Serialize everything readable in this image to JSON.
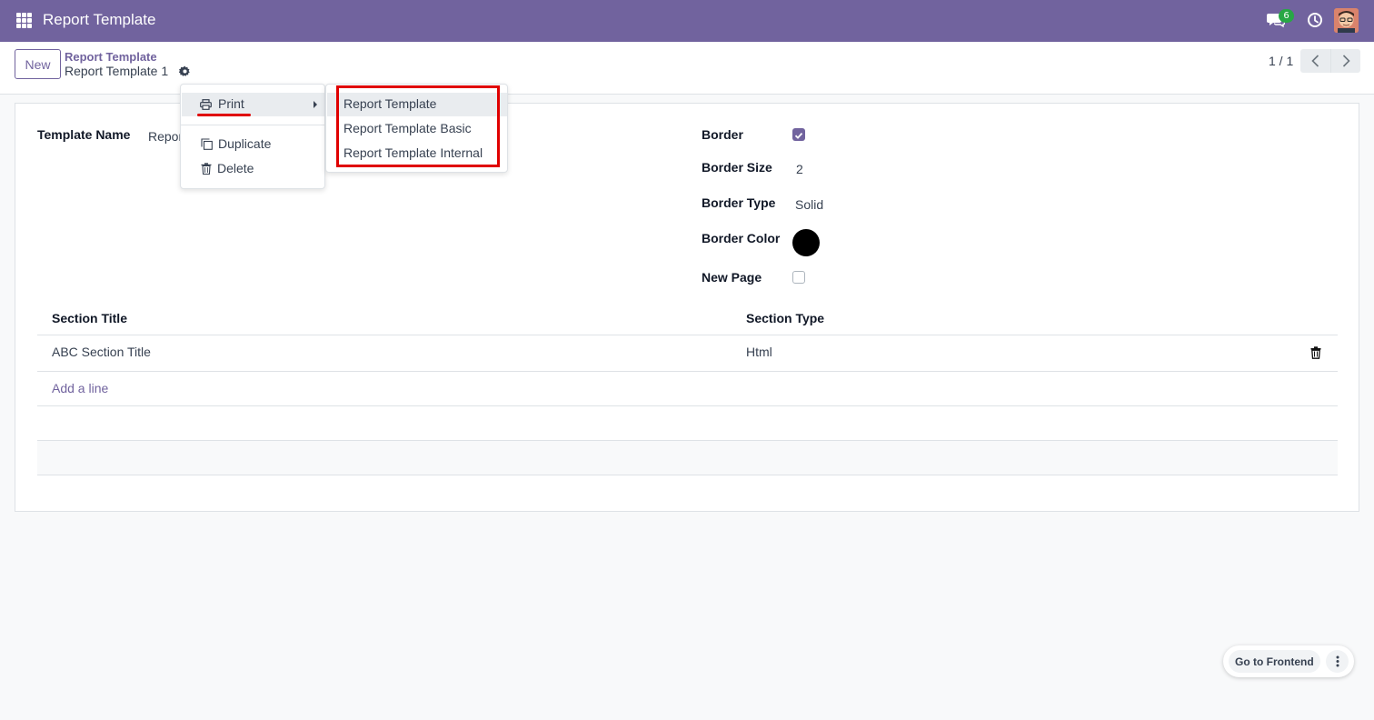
{
  "navbar": {
    "title": "Report Template",
    "chat_count": "6"
  },
  "control_panel": {
    "new_label": "New",
    "breadcrumb_parent": "Report Template",
    "breadcrumb_current": "Report Template 1",
    "pager": "1 / 1"
  },
  "form": {
    "template_name_label": "Template Name",
    "template_name_value": "Report Template 1",
    "template_name_visible": "Repor",
    "border_label": "Border",
    "border_checked": true,
    "border_size_label": "Border Size",
    "border_size_value": "2",
    "border_type_label": "Border Type",
    "border_type_value": "Solid",
    "border_color_label": "Border Color",
    "border_color_value": "#000000",
    "new_page_label": "New Page",
    "new_page_checked": false
  },
  "table": {
    "columns": [
      "Section Title",
      "Section Type"
    ],
    "rows": [
      {
        "section_title": "ABC Section Title",
        "section_type": "Html"
      }
    ],
    "add_line": "Add a line"
  },
  "action_menu": {
    "print_label": "Print",
    "duplicate_label": "Duplicate",
    "delete_label": "Delete",
    "print_submenu": [
      "Report Template",
      "Report Template Basic",
      "Report Template Internal"
    ]
  },
  "floating": {
    "go_frontend": "Go to Frontend"
  },
  "colors": {
    "brand": "#71639e",
    "highlight": "#e00000",
    "badge": "#28a745"
  }
}
